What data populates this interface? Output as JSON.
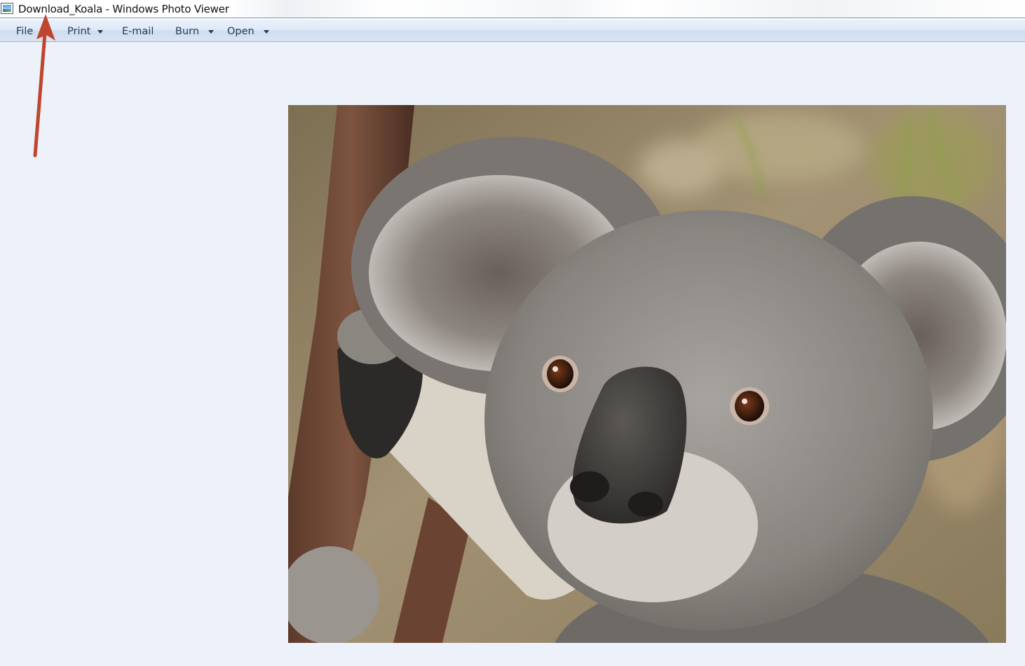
{
  "window": {
    "title": "Download_Koala - Windows Photo Viewer",
    "icon": "photo-viewer-icon"
  },
  "toolbar": {
    "items": [
      {
        "label": "File",
        "has_dropdown": false
      },
      {
        "label": "Print",
        "has_dropdown": true
      },
      {
        "label": "E-mail",
        "has_dropdown": false
      },
      {
        "label": "Burn",
        "has_dropdown": true
      },
      {
        "label": "Open",
        "has_dropdown": true
      }
    ]
  },
  "image": {
    "subject": "koala-photo"
  },
  "annotation": {
    "type": "arrow",
    "color": "#c0452f",
    "points_to": "title-text"
  },
  "colors": {
    "background": "#edf2fa",
    "toolbar_text": "#1e395b",
    "arrow": "#c0452f"
  }
}
